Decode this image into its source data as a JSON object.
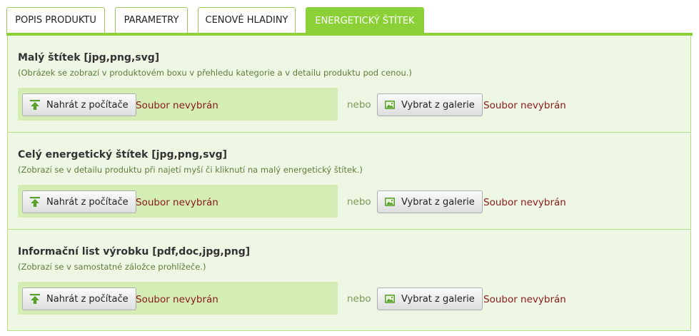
{
  "tabs": [
    {
      "label": "POPIS PRODUKTU",
      "active": false
    },
    {
      "label": "PARAMETRY",
      "active": false
    },
    {
      "label": "CENOVÉ HLADINY",
      "active": false
    },
    {
      "label": "ENERGETICKÝ ŠTÍTEK",
      "active": true
    }
  ],
  "sections": [
    {
      "title": "Malý štítek [jpg,png,svg]",
      "description": "(Obrázek se zobrazí v produktovém boxu v přehledu kategorie a v detailu produktu pod cenou.)",
      "upload_label": "Nahrát z počítače",
      "upload_status": "Soubor nevybrán",
      "or_label": "nebo",
      "gallery_label": "Vybrat z galerie",
      "gallery_status": "Soubor nevybrán"
    },
    {
      "title": "Celý energetický štítek [jpg,png,svg]",
      "description": "(Zobrazí se v detailu produktu při najetí myší či kliknutí na malý energetický štítek.)",
      "upload_label": "Nahrát z počítače",
      "upload_status": "Soubor nevybrán",
      "or_label": "nebo",
      "gallery_label": "Vybrat z galerie",
      "gallery_status": "Soubor nevybrán"
    },
    {
      "title": "Informační list výrobku [pdf,doc,jpg,png]",
      "description": "(Zobrazí se v samostatné záložce prohlížeče.)",
      "upload_label": "Nahrát z počítače",
      "upload_status": "Soubor nevybrán",
      "or_label": "nebo",
      "gallery_label": "Vybrat z galerie",
      "gallery_status": "Soubor nevybrán"
    }
  ],
  "icons": {
    "upload": "upload-arrow-icon",
    "gallery": "image-gallery-icon"
  },
  "colors": {
    "accent": "#8cd038",
    "panel_bg": "#eef7e4",
    "upload_box": "#d3edb4",
    "error_text": "#8b1a1a",
    "hint_text": "#5c7d3a"
  }
}
